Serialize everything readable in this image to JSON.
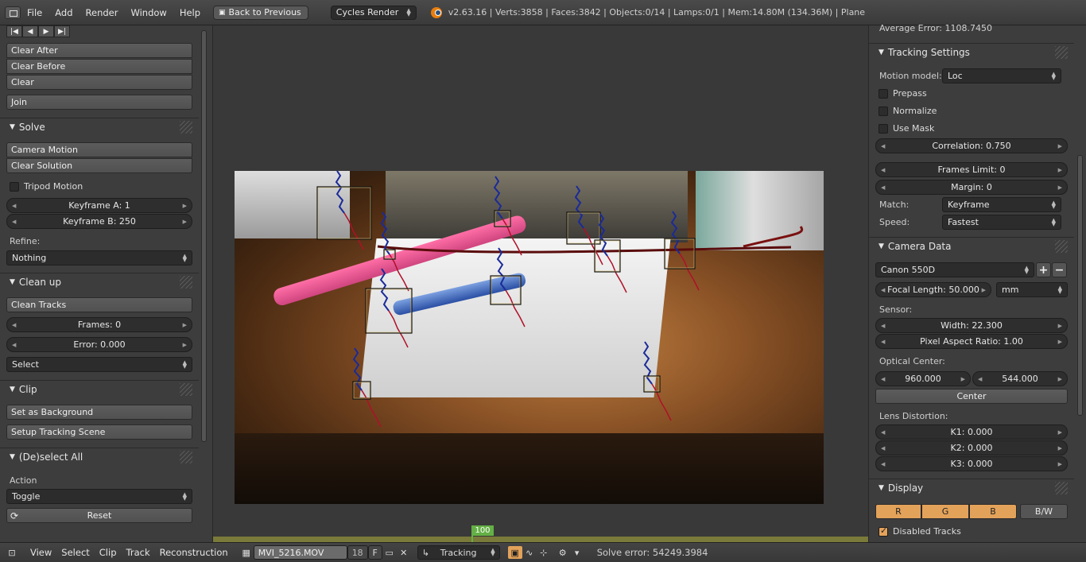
{
  "topbar": {
    "menu": [
      "File",
      "Add",
      "Render",
      "Window",
      "Help"
    ],
    "back_label": "Back to Previous",
    "render_engine": "Cycles Render",
    "stats": "v2.63.16 | Verts:3858 | Faces:3842 | Objects:0/14 | Lamps:0/1 | Mem:14.80M (134.36M) | Plane"
  },
  "left": {
    "clear_after": "Clear After",
    "clear_before": "Clear Before",
    "clear": "Clear",
    "join": "Join",
    "solve_header": "Solve",
    "camera_motion": "Camera Motion",
    "clear_solution": "Clear Solution",
    "tripod_motion": "Tripod Motion",
    "keyframe_a": "Keyframe A: 1",
    "keyframe_b": "Keyframe B: 250",
    "refine_label": "Refine:",
    "refine_value": "Nothing",
    "cleanup_header": "Clean up",
    "clean_tracks": "Clean Tracks",
    "frames": "Frames: 0",
    "error": "Error: 0.000",
    "select_value": "Select",
    "clip_header": "Clip",
    "set_background": "Set as Background",
    "setup_tracking": "Setup Tracking Scene",
    "deselect_header": "(De)select All",
    "action_label": "Action",
    "action_value": "Toggle",
    "reset": "Reset"
  },
  "right": {
    "average_error": "Average Error: 1108.7450",
    "tracking_settings_header": "Tracking Settings",
    "motion_model_label": "Motion model:",
    "motion_model_value": "Loc",
    "prepass": "Prepass",
    "normalize": "Normalize",
    "use_mask": "Use Mask",
    "correlation": "Correlation: 0.750",
    "frames_limit": "Frames Limit: 0",
    "margin": "Margin: 0",
    "match_label": "Match:",
    "match_value": "Keyframe",
    "speed_label": "Speed:",
    "speed_value": "Fastest",
    "camera_data_header": "Camera Data",
    "camera_preset": "Canon 550D",
    "focal_length": "Focal Length: 50.000",
    "focal_unit": "mm",
    "sensor_label": "Sensor:",
    "width": "Width: 22.300",
    "pixel_aspect": "Pixel Aspect Ratio: 1.00",
    "optical_center_label": "Optical Center:",
    "optical_x": "960.000",
    "optical_y": "544.000",
    "center_button": "Center",
    "lens_distortion_label": "Lens Distortion:",
    "k1": "K1: 0.000",
    "k2": "K2: 0.000",
    "k3": "K3: 0.000",
    "display_header": "Display",
    "channel_r": "R",
    "channel_g": "G",
    "channel_b": "B",
    "channel_bw": "B/W",
    "disabled_tracks": "Disabled Tracks"
  },
  "timeline": {
    "current_frame": "100"
  },
  "bottombar": {
    "menus": [
      "View",
      "Select",
      "Clip",
      "Track",
      "Reconstruction"
    ],
    "clip_name": "MVI_5216.MOV",
    "users": "18",
    "fake_user": "F",
    "mode": "Tracking",
    "solve_error": "Solve error: 54249.3984"
  },
  "colors": {
    "accent": "#e3a25a",
    "frame_marker": "#64b045",
    "track_past": "#1a2a9a",
    "track_future": "#b0102a"
  }
}
